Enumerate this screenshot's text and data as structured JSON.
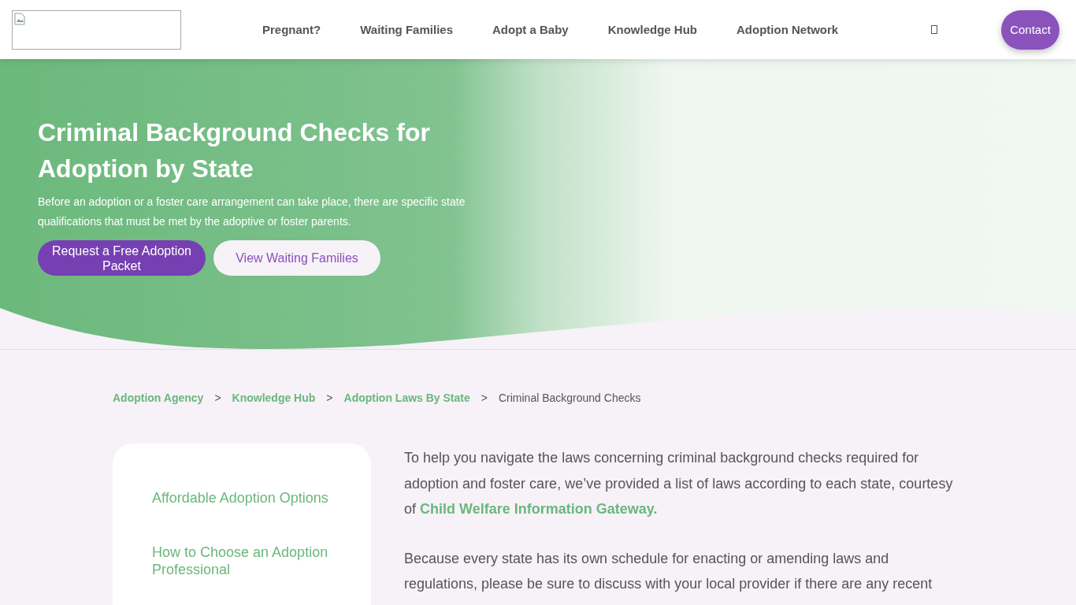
{
  "header": {
    "nav": [
      "Pregnant?",
      "Waiting Families",
      "Adopt a Baby",
      "Knowledge Hub",
      "Adoption Network"
    ],
    "contact": "Contact"
  },
  "hero": {
    "title": "Criminal Background Checks for Adoption by State",
    "subtitle": "Before an adoption or a foster care arrangement can take place, there are specific state qualifications that must be met by the adoptive or foster parents.",
    "buttons": [
      {
        "label": "Request a Free Adoption Packet",
        "kind": "primary"
      },
      {
        "label": "View Waiting Families",
        "kind": "secondary"
      }
    ]
  },
  "breadcrumb": [
    {
      "label": "Adoption Agency",
      "current": false
    },
    {
      "separator": ">",
      "label": "Knowledge Hub",
      "current": false
    },
    {
      "separator": ">",
      "label": "Adoption Laws By State",
      "current": false
    },
    {
      "separator": ">",
      "label": "Criminal Background Checks",
      "current": true
    }
  ],
  "sidebar": {
    "items": [
      "Affordable Adoption Options",
      "How to Choose an Adoption Professional"
    ]
  },
  "content": {
    "paragraphs": [
      "To help you navigate the laws concerning criminal background checks required for adoption and foster care, we’ve provided a list of laws according to each state, courtesy of **Child Welfare Information Gateway.**",
      "Because every state has its own schedule for enacting or amending laws and regulations, please be sure to discuss with your local provider if there are any recent"
    ]
  }
}
